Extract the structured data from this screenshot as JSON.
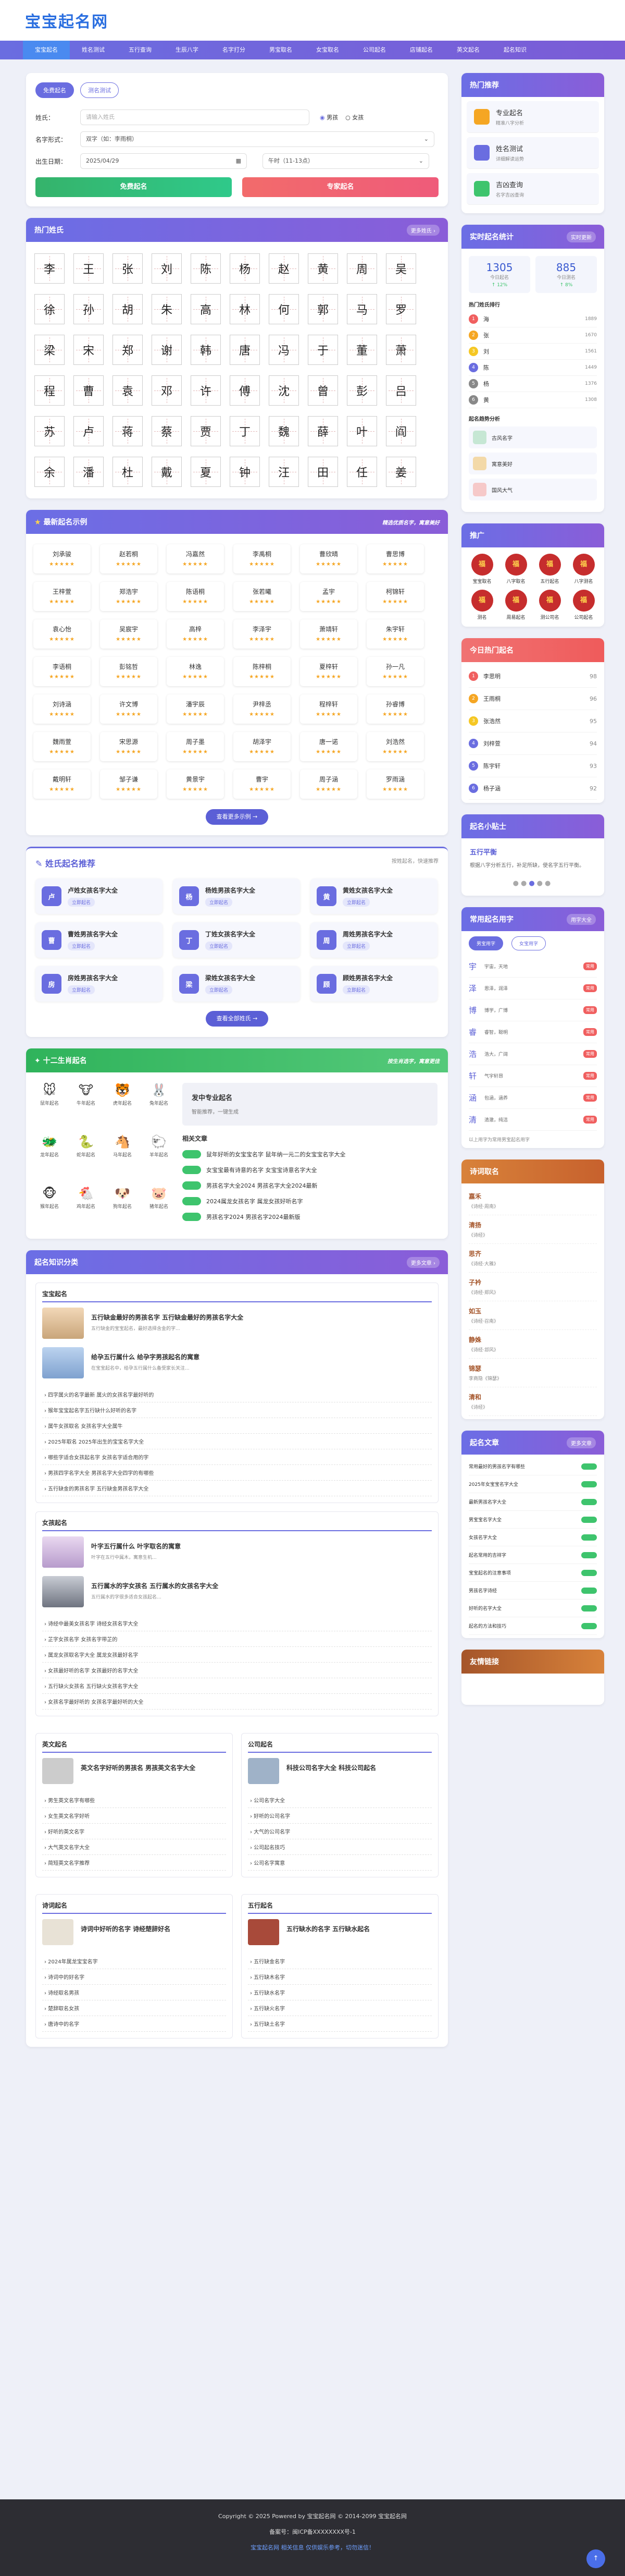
{
  "brand": {
    "logo": "宝宝起名网"
  },
  "nav": [
    "宝宝起名",
    "姓名测试",
    "五行查询",
    "生辰八字",
    "名字打分",
    "男宝取名",
    "女宝取名",
    "公司起名",
    "店铺起名",
    "英文起名",
    "起名知识"
  ],
  "form": {
    "tab1": "免费起名",
    "tab2": "测名测试",
    "surname_label": "姓氏：",
    "surname_placeholder": "请输入姓氏",
    "boy": "男孩",
    "girl": "女孩",
    "style_label": "名字形式：",
    "style_value": "双字（如：李雨桐）",
    "birth_label": "出生日期：",
    "birth_value": "2025/04/29",
    "time_value": "午时（11-13点）",
    "btn1": "免费起名",
    "btn2": "专家起名"
  },
  "surnames": {
    "title": "热门姓氏",
    "more": "更多姓氏 ›",
    "list": [
      "李",
      "王",
      "张",
      "刘",
      "陈",
      "杨",
      "赵",
      "黄",
      "周",
      "吴",
      "徐",
      "孙",
      "胡",
      "朱",
      "高",
      "林",
      "何",
      "郭",
      "马",
      "罗",
      "梁",
      "宋",
      "郑",
      "谢",
      "韩",
      "唐",
      "冯",
      "于",
      "董",
      "萧",
      "程",
      "曹",
      "袁",
      "邓",
      "许",
      "傅",
      "沈",
      "曾",
      "彭",
      "吕",
      "苏",
      "卢",
      "蒋",
      "蔡",
      "贾",
      "丁",
      "魏",
      "薛",
      "叶",
      "阎",
      "余",
      "潘",
      "杜",
      "戴",
      "夏",
      "钟",
      "汪",
      "田",
      "任",
      "姜"
    ]
  },
  "names": {
    "title": "最新起名示例",
    "sub": "精选优质名字，寓意美好",
    "stars": "★★★★★",
    "list": [
      "刘承骏",
      "赵若桐",
      "冯嘉然",
      "李禹桐",
      "曹欣晴",
      "曹思博",
      "王梓萱",
      "郑浩宇",
      "陈语桐",
      "张若曦",
      "孟宇",
      "柯锦轩",
      "袁心怡",
      "吴宸宇",
      "高梓",
      "李泽宇",
      "萧靖轩",
      "朱宇轩",
      "李语桐",
      "彭铭哲",
      "林逸",
      "陈梓桐",
      "夏梓轩",
      "孙一凡",
      "刘诗涵",
      "许文博",
      "潘宇辰",
      "尹梓丞",
      "程梓轩",
      "孙睿博",
      "魏雨萱",
      "宋思源",
      "周子墨",
      "胡泽宇",
      "唐一诺",
      "刘浩然",
      "戴明轩",
      "邹子谦",
      "黄景宇",
      "曹宇",
      "周子涵",
      "罗雨涵"
    ],
    "more": "查看更多示例 →"
  },
  "xing": {
    "title": "姓氏起名推荐",
    "sub": "按姓起名，快速推荐",
    "badge": "立即起名",
    "list": [
      {
        "i": "卢",
        "t": "卢姓女孩名字大全"
      },
      {
        "i": "杨",
        "t": "杨姓男孩名字大全"
      },
      {
        "i": "黄",
        "t": "黄姓女孩名字大全"
      },
      {
        "i": "曹",
        "t": "曹姓男孩名字大全"
      },
      {
        "i": "丁",
        "t": "丁姓女孩名字大全"
      },
      {
        "i": "周",
        "t": "周姓男孩名字大全"
      },
      {
        "i": "房",
        "t": "房姓男孩名字大全"
      },
      {
        "i": "梁",
        "t": "梁姓女孩名字大全"
      },
      {
        "i": "顾",
        "t": "顾姓男孩名字大全"
      }
    ],
    "more": "查看全部姓氏 →"
  },
  "zodiac": {
    "title": "十二生肖起名",
    "sub": "按生肖选字，寓意更佳",
    "items": [
      {
        "e": "🐭",
        "l": "鼠年起名"
      },
      {
        "e": "🐮",
        "l": "牛年起名"
      },
      {
        "e": "🐯",
        "l": "虎年起名"
      },
      {
        "e": "🐰",
        "l": "兔年起名"
      },
      {
        "e": "🐲",
        "l": "龙年起名"
      },
      {
        "e": "🐍",
        "l": "蛇年起名"
      },
      {
        "e": "🐴",
        "l": "马年起名"
      },
      {
        "e": "🐑",
        "l": "羊年起名"
      },
      {
        "e": "🐵",
        "l": "猴年起名"
      },
      {
        "e": "🐔",
        "l": "鸡年起名"
      },
      {
        "e": "🐶",
        "l": "狗年起名"
      },
      {
        "e": "🐷",
        "l": "猪年起名"
      }
    ],
    "promo_t": "发中专业起名",
    "promo_d": "智能推荐，一键生成",
    "rel": "相关文章",
    "links": [
      "鼠年好听的女宝宝名字 鼠年纳一元二的女宝宝名字大全",
      "女宝宝最有诗意的名字 女宝宝诗意名字大全",
      "男孩名字大全2024 男孩名字大全2024最新",
      "2024属龙女孩名字 属龙女孩好听名字",
      "男孩名字2024 男孩名字2024最新版"
    ]
  },
  "know": {
    "title": "起名知识分类",
    "more": "更多文章 ›",
    "c1": {
      "title": "宝宝起名",
      "f1t": "五行缺金最好的男孩名字 五行缺金最好的男孩名字大全",
      "f1d": "五行缺金的宝宝起名，最好选择含金的字...",
      "f2t": "给孕五行属什么 给孕字男孩起名的寓意",
      "f2d": "在宝宝起名中，给孕五行属什么备受家长关注...",
      "items": [
        "四字属火的名字最新 属火的女孩名字最好听的",
        "猴年宝宝起名字五行缺什么好听的名字",
        "属牛女孩取名 女孩名字大全属牛",
        "2025年取名 2025年出生的宝宝名字大全",
        "哪些字适合女孩起名字 女孩名字适合用的字",
        "男孩四字名字大全 男孩名字大全四字的有哪些",
        "五行缺金的男孩名字 五行缺金男孩名字大全"
      ]
    },
    "c2": {
      "title": "女孩起名",
      "f1t": "叶字五行属什么 叶字取名的寓意",
      "f1d": "叶字在五行中属木，寓意生机...",
      "f2t": "五行属水的字女孩名 五行属水的女孩名字大全",
      "f2d": "五行属水的字很多适合女孩起名...",
      "items": [
        "诗经中最美女孩名字 诗经女孩名字大全",
        "芷字女孩名字 女孩名字带芷的",
        "属龙女孩取名字大全 属龙女孩最好名字",
        "女孩最好听的名字 女孩最好的名字大全",
        "五行缺火女孩名 五行缺火女孩名字大全",
        "女孩名字最好听的 女孩名字最好听的大全"
      ]
    },
    "c3": {
      "title": "英文起名",
      "ft": "英文名字好听的男孩名 男孩英文名字大全",
      "items": [
        "男生英文名字有哪些",
        "女生英文名字好听",
        "好听的英文名字",
        "大气英文名字大全",
        "简短英文名字推荐"
      ]
    },
    "c4": {
      "title": "公司起名",
      "ft": "科技公司名字大全 科技公司起名",
      "items": [
        "公司名字大全",
        "好听的公司名字",
        "大气的公司名字",
        "公司起名技巧",
        "公司名字寓意"
      ]
    },
    "c5": {
      "title": "诗词起名",
      "ft": "诗词中好听的名字 诗经楚辞好名",
      "items": [
        "2024年属龙宝宝名字",
        "诗词中的好名字",
        "诗经取名男孩",
        "楚辞取名女孩",
        "唐诗中的名字"
      ]
    },
    "c6": {
      "title": "五行起名",
      "ft": "五行缺水的名字 五行缺水起名",
      "items": [
        "五行缺金名字",
        "五行缺木名字",
        "五行缺水名字",
        "五行缺火名字",
        "五行缺土名字"
      ]
    }
  },
  "side": {
    "hot_title": "热门推荐",
    "hot": [
      {
        "t": "专业起名",
        "d": "精准八字分析"
      },
      {
        "t": "姓名测试",
        "d": "详细解读运势"
      },
      {
        "t": "吉凶查询",
        "d": "名字吉凶查询"
      }
    ],
    "stats_title": "实时起名统计",
    "stats_badge": "实时更新",
    "s1": "1305",
    "s1l": "今日起名",
    "s1u": "↑ 12%",
    "s2": "885",
    "s2l": "今日测名",
    "s2u": "↑ 8%",
    "rank_title": "热门姓氏排行",
    "rank": [
      {
        "n": "海",
        "v": "1889"
      },
      {
        "n": "张",
        "v": "1670"
      },
      {
        "n": "刘",
        "v": "1561"
      },
      {
        "n": "陈",
        "v": "1449"
      },
      {
        "n": "杨",
        "v": "1376"
      },
      {
        "n": "黄",
        "v": "1308"
      }
    ],
    "trend_title": "起名趋势分析",
    "trends": [
      {
        "t": "古风名字",
        "c": "#c6e7d4"
      },
      {
        "t": "寓意美好",
        "c": "#f3d9a8"
      },
      {
        "t": "国风大气",
        "c": "#f6c9c9"
      }
    ],
    "ad_title": "推广",
    "ad_items": [
      "宝宝取名",
      "八字取名",
      "五行起名",
      "八字测名",
      "测名",
      "周易起名",
      "测公司名",
      "公司起名"
    ],
    "daily_title": "今日热门起名",
    "daily": [
      {
        "n": "李思明",
        "s": "98"
      },
      {
        "n": "王雨桐",
        "s": "96"
      },
      {
        "n": "张浩然",
        "s": "95"
      },
      {
        "n": "刘梓萱",
        "s": "94"
      },
      {
        "n": "陈宇轩",
        "s": "93"
      },
      {
        "n": "杨子涵",
        "s": "92"
      }
    ],
    "tip_title": "起名小贴士",
    "tip_t": "五行平衡",
    "tip_d": "根据八字分析五行，补足所缺，使名字五行平衡。",
    "char_title": "常用起名用字",
    "char_badge": "用字大全",
    "char_tab1": "男宝用字",
    "char_tab2": "女宝用字",
    "chars": [
      {
        "c": "宇",
        "d": "宇宙，天地"
      },
      {
        "c": "泽",
        "d": "恩泽，润泽"
      },
      {
        "c": "博",
        "d": "博学，广博"
      },
      {
        "c": "睿",
        "d": "睿智，聪明"
      },
      {
        "c": "浩",
        "d": "浩大，广阔"
      },
      {
        "c": "轩",
        "d": "气宇轩昂"
      },
      {
        "c": "涵",
        "d": "包涵，涵养"
      },
      {
        "c": "清",
        "d": "清澈，纯洁"
      }
    ],
    "char_note": "以上用字为常用男宝起名用字",
    "poet_title": "诗词取名",
    "poet": [
      {
        "n": "嘉禾",
        "s": "《诗经·周南》"
      },
      {
        "n": "清扬",
        "s": "《诗经》"
      },
      {
        "n": "思齐",
        "s": "《诗经·大雅》"
      },
      {
        "n": "子衿",
        "s": "《诗经·郑风》"
      },
      {
        "n": "如玉",
        "s": "《诗经·召南》"
      },
      {
        "n": "静姝",
        "s": "《诗经·邶风》"
      },
      {
        "n": "锦瑟",
        "s": "李商隐《锦瑟》"
      },
      {
        "n": "清和",
        "s": "《诗经》"
      }
    ],
    "art_title": "起名文章",
    "art_badge": "更多文章",
    "arts": [
      "常用最好的男孩名字有哪些",
      "2025年女宝宝名字大全",
      "最新男孩名字大全",
      "男宝宝名字大全",
      "女孩名字大全",
      "起名常用的吉祥字",
      "宝宝起名的注意事项",
      "男孩名字诗经",
      "好听的名字大全",
      "起名的方法和技巧"
    ],
    "foot_title": "友情链接"
  },
  "footer": {
    "c1": "Copyright © 2025 Powered by 宝宝起名网 © 2014-2099 宝宝起名网",
    "c2": "备案号：闽ICP备XXXXXXXX号-1",
    "c3": "宝宝起名网 相关信息 仅供娱乐参考，切勿迷信！"
  },
  "colors": {
    "primary": "#6a6de0",
    "accent": "#2b6fe0",
    "green": "#3ec46d",
    "red": "#f05f5f"
  }
}
